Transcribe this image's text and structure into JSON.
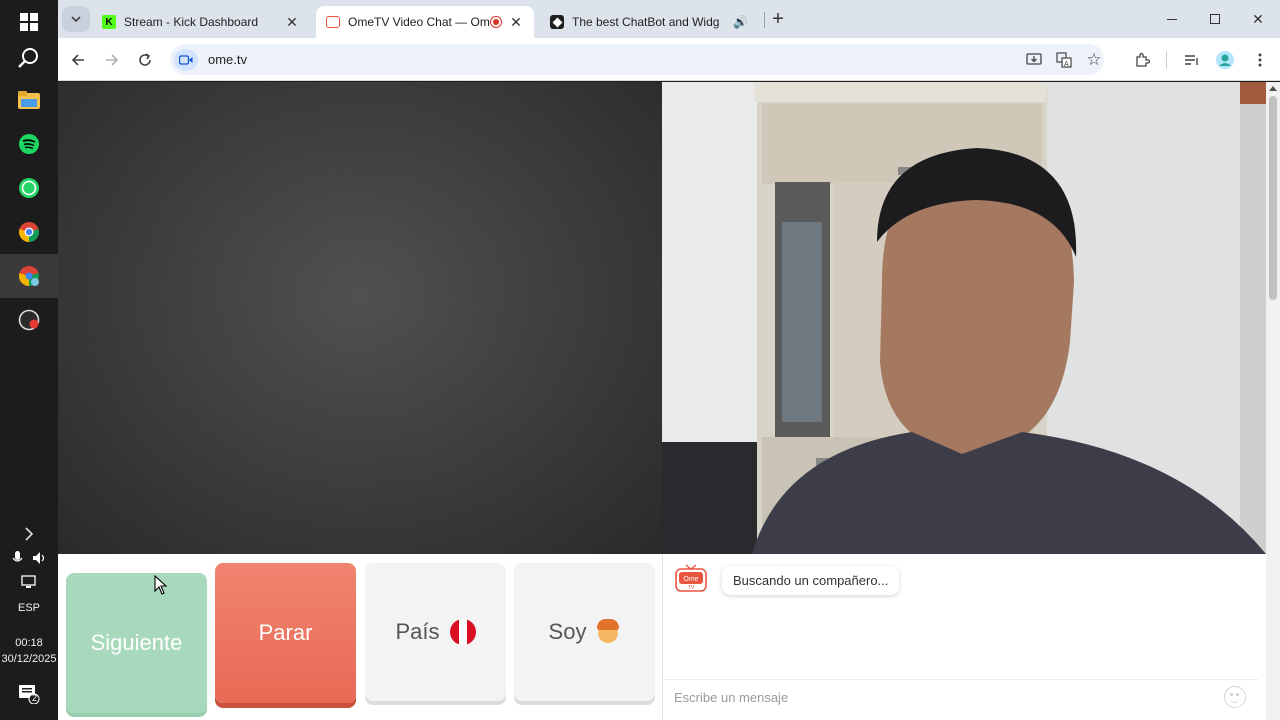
{
  "taskbar": {
    "lang": "ESP",
    "time": "00:18",
    "date": "30/12/2025",
    "notification_count": "2"
  },
  "browser": {
    "tabs": [
      {
        "title": "Stream - Kick Dashboard",
        "icon": "kick-logo-icon"
      },
      {
        "title": "OmeTV Video Chat — Ome",
        "icon": "ometv-logo-icon",
        "recording": true
      },
      {
        "title": "The best ChatBot and Widg",
        "icon": "chatbot-logo-icon",
        "audio": true
      }
    ],
    "url": "ome.tv"
  },
  "controls": {
    "next_label": "Siguiente",
    "stop_label": "Parar",
    "country_label": "País",
    "gender_label": "Soy"
  },
  "chat": {
    "status_message": "Buscando un compañero...",
    "input_placeholder": "Escribe un mensaje",
    "logo_text": "Ome TV"
  },
  "colors": {
    "next_button": "#a9d9bd",
    "stop_button": "#eb715c",
    "country_flag_red": "#d91023"
  }
}
